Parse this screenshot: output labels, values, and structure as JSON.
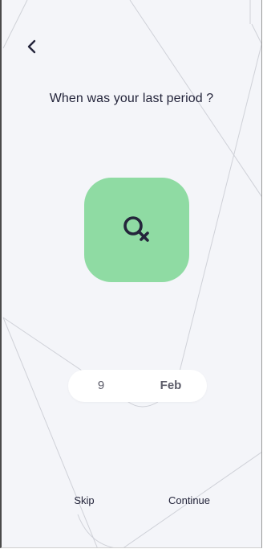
{
  "header": {
    "back_icon": "chevron-left-icon"
  },
  "question": {
    "text": "When was your last period ?"
  },
  "illustration": {
    "icon": "female-symbol-icon",
    "tile_color": "#8fdba3"
  },
  "date_picker": {
    "day": "9",
    "month": "Feb"
  },
  "footer": {
    "skip_label": "Skip",
    "continue_label": "Continue"
  },
  "colors": {
    "background": "#f4f5f9",
    "text": "#24253b",
    "accent": "#8fdba3"
  }
}
